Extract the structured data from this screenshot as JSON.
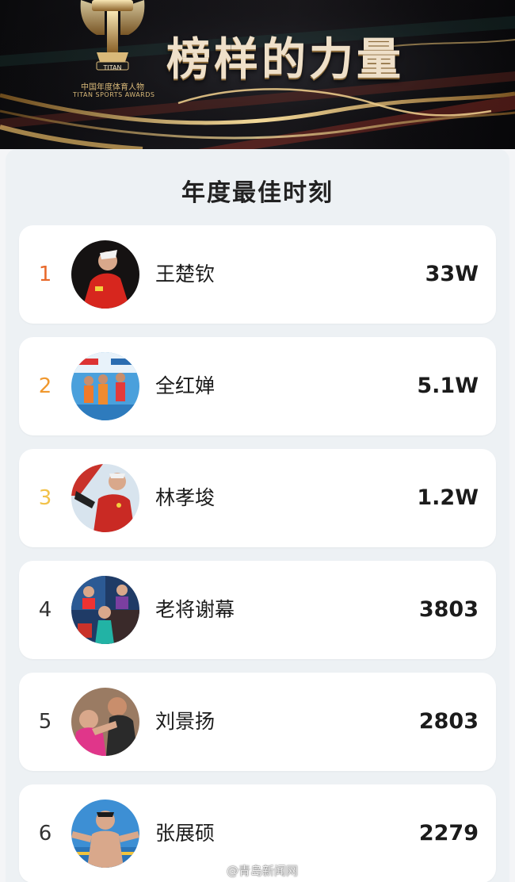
{
  "banner": {
    "title": "榜样的力量",
    "logo_brand": "TITAN",
    "logo_caption_cn": "中国年度体育人物",
    "logo_caption_en": "TITAN SPORTS AWARDS",
    "logo_icon": "trophy-t-logo"
  },
  "section": {
    "title": "年度最佳时刻"
  },
  "rankings": [
    {
      "rank": "1",
      "name": "王楚钦",
      "votes": "33W"
    },
    {
      "rank": "2",
      "name": "全红婵",
      "votes": "5.1W"
    },
    {
      "rank": "3",
      "name": "林孝埈",
      "votes": "1.2W"
    },
    {
      "rank": "4",
      "name": "老将谢幕",
      "votes": "3803"
    },
    {
      "rank": "5",
      "name": "刘景扬",
      "votes": "2803"
    },
    {
      "rank": "6",
      "name": "张展硕",
      "votes": "2279"
    }
  ],
  "watermark": {
    "text": "@青岛新闻网",
    "icon": "weibo-icon"
  },
  "colors": {
    "rank1": "#e8692b",
    "rank2": "#f0982e",
    "rank3": "#f2c24a",
    "card_bg": "#edf1f4",
    "row_bg": "#ffffff",
    "gold": "#d9b979"
  }
}
